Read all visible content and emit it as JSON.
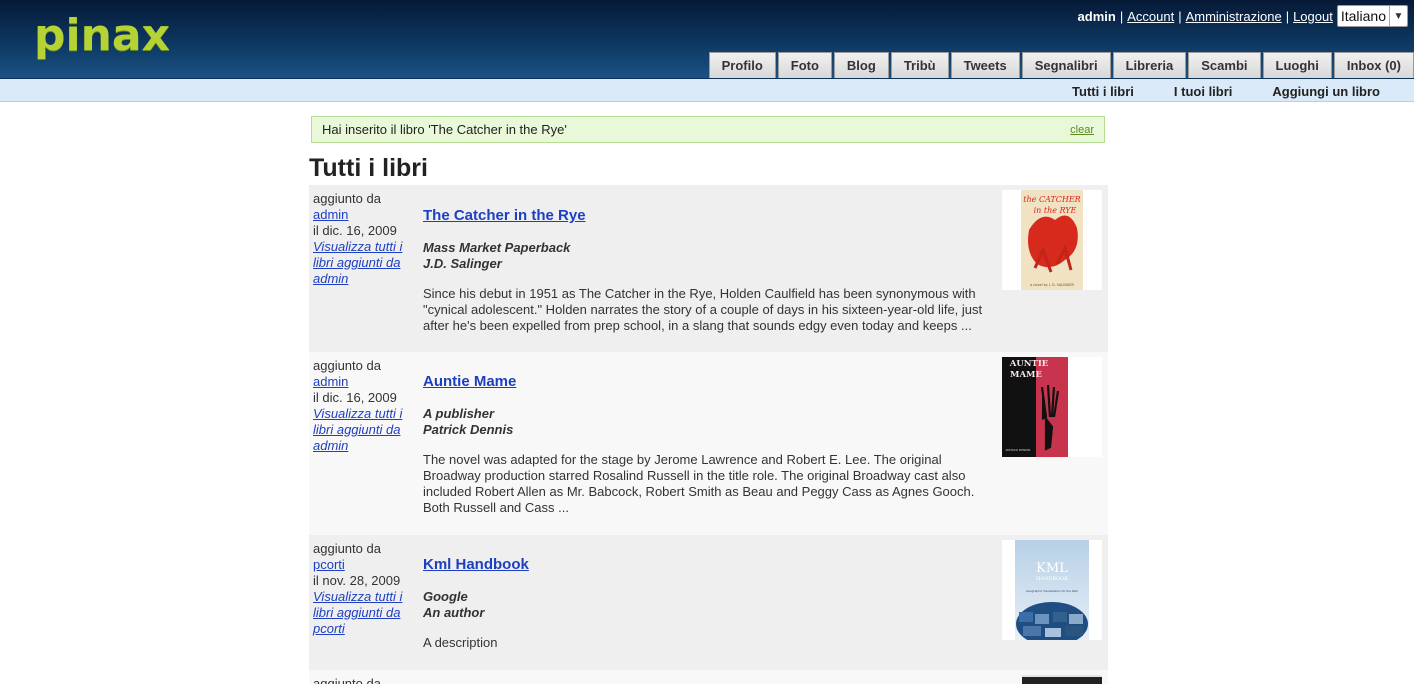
{
  "header": {
    "logo": "pinax",
    "user": "admin",
    "links": [
      "Account",
      "Amministrazione",
      "Logout"
    ],
    "language": "Italiano",
    "tabs": [
      "Profilo",
      "Foto",
      "Blog",
      "Tribù",
      "Tweets",
      "Segnalibri",
      "Libreria",
      "Scambi",
      "Luoghi",
      "Inbox (0)"
    ]
  },
  "subnav": [
    "Tutti i libri",
    "I tuoi libri",
    "Aggiungi un libro"
  ],
  "message": {
    "text": "Hai inserito il libro 'The Catcher in the Rye'",
    "clear": "clear"
  },
  "page_title": "Tutti i libri",
  "books": [
    {
      "added_by_label": "aggiunto da",
      "user": "admin",
      "date": "il dic. 16, 2009",
      "view_all_link": "Visualizza tutti i libri aggiunti da admin",
      "title": "The Catcher in the Rye",
      "publisher": "Mass Market Paperback",
      "author": "J.D. Salinger",
      "description": "Since his debut in 1951 as The Catcher in the Rye, Holden Caulfield has been synonymous with \"cynical adolescent.\" Holden narrates the story of a couple of days in his sixteen-year-old life, just after he's been expelled from prep school, in a slang that sounds edgy even today and keeps ...",
      "cover": {
        "line1": "the CATCHER",
        "line2": "in the RYE",
        "foot": "a novel by J. D. SALINGER"
      }
    },
    {
      "added_by_label": "aggiunto da",
      "user": "admin",
      "date": "il dic. 16, 2009",
      "view_all_link": "Visualizza tutti i libri aggiunti da admin",
      "title": "Auntie Mame",
      "publisher": "A publisher",
      "author": "Patrick Dennis",
      "description": "The novel was adapted for the stage by Jerome Lawrence and Robert E. Lee. The original Broadway production starred Rosalind Russell in the title role. The original Broadway cast also included Robert Allen as Mr. Babcock, Robert Smith as Beau and Peggy Cass as Agnes Gooch. Both Russell and Cass ...",
      "cover": {
        "line1": "AUNTIE",
        "line2": "MAME",
        "foot": "PATRICK DENNIS"
      }
    },
    {
      "added_by_label": "aggiunto da",
      "user": "pcorti",
      "date": "il nov. 28, 2009",
      "view_all_link": "Visualizza tutti i libri aggiunti da pcorti",
      "title": "Kml Handbook",
      "publisher": "Google",
      "author": "An author",
      "description": "A description",
      "cover": {
        "line1": "KML",
        "line2": "HANDBOOK",
        "foot": "Geographic Visualization for the Web"
      }
    },
    {
      "added_by_label": "aggiunto da"
    }
  ],
  "colors": {
    "header_top": "#061a36",
    "logo": "#b5d334",
    "link": "#1d3fc2",
    "subnav": "#dbeaf8",
    "message_bg": "#e8f8d9"
  }
}
